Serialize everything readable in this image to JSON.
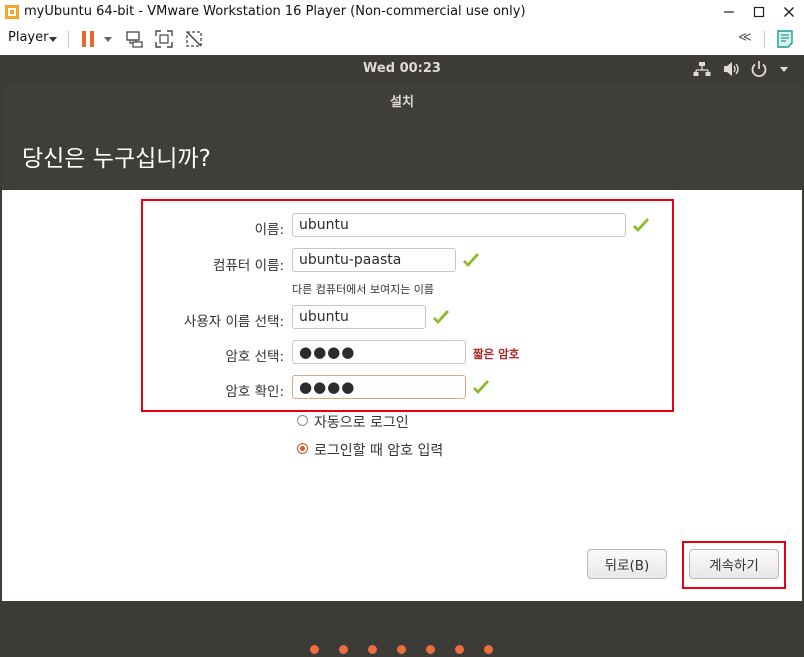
{
  "window": {
    "title": "myUbuntu 64-bit - VMware Workstation 16 Player (Non-commercial use only)",
    "controls": [
      "minimize-icon",
      "maximize-icon",
      "close-icon"
    ]
  },
  "toolbar": {
    "player_label": "Player",
    "icons": [
      "pause-icon",
      "send-ctrl-alt-del-icon",
      "fit-guest-icon",
      "unity-mode-icon",
      "collapse-icon",
      "notes-icon"
    ],
    "collapse_glyph": "≪"
  },
  "ubuntu_panel": {
    "clock": "Wed 00:23",
    "icons": [
      "network-icon",
      "volume-icon",
      "power-icon"
    ]
  },
  "installer": {
    "window_title": "설치",
    "heading": "당신은 누구십니까?",
    "form": {
      "name_label": "이름:",
      "name_value": "ubuntu",
      "computer_label": "컴퓨터 이름:",
      "computer_value": "ubuntu-paasta",
      "computer_hint": "다른 컴퓨터에서 보여지는 이름",
      "username_label": "사용자 이름 선택:",
      "username_value": "ubuntu",
      "password_label": "암호 선택:",
      "password_value": "●●●●",
      "password_warning": "짧은 암호",
      "confirm_label": "암호 확인:",
      "confirm_value": "●●●●"
    },
    "login_options": {
      "auto_login": "자동으로 로그인",
      "require_password": "로그인할 때 암호 입력",
      "selected": "require_password"
    },
    "buttons": {
      "back": "뒤로(B)",
      "continue": "계속하기"
    },
    "progress": {
      "total_steps": 7
    },
    "colors": {
      "accent": "#e9703e",
      "panel": "#3c3b37",
      "check": "#8cbb2f",
      "warning": "#b32424",
      "annotation": "#e60012"
    }
  }
}
